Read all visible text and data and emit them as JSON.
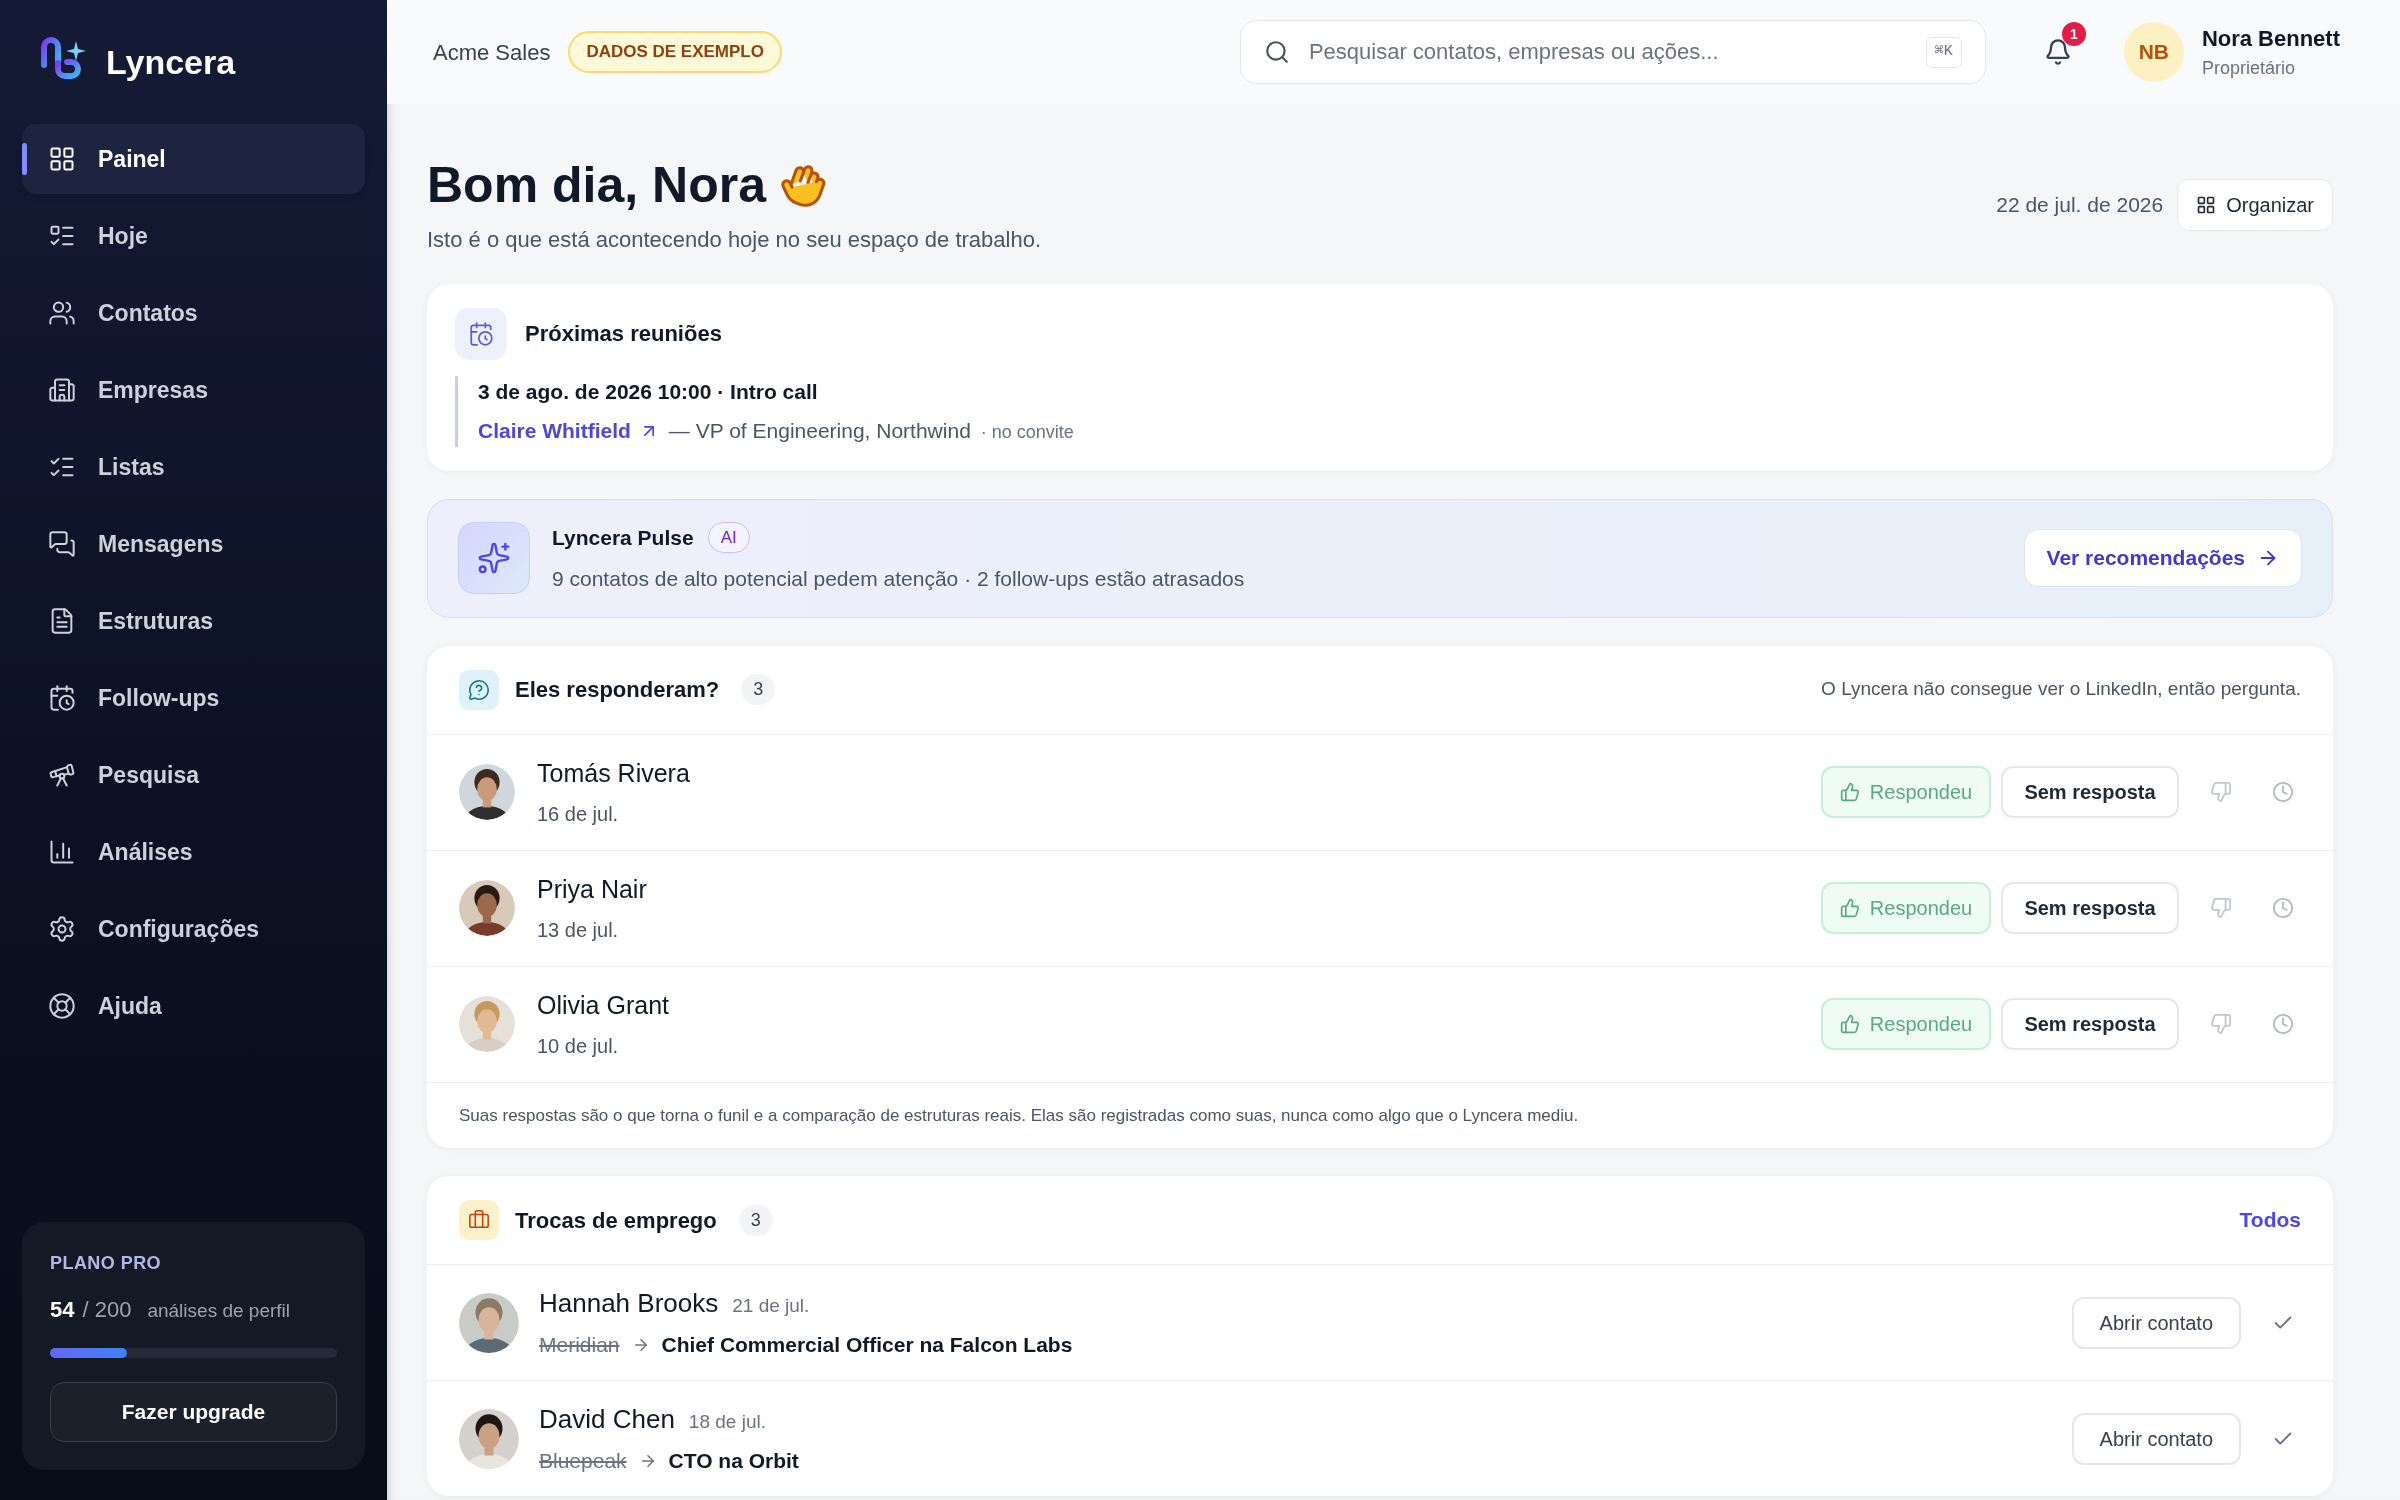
{
  "sidebar": {
    "brand": "Lyncera",
    "items": [
      {
        "label": "Painel",
        "selected": true
      },
      {
        "label": "Hoje",
        "selected": false
      },
      {
        "label": "Contatos",
        "selected": false
      },
      {
        "label": "Empresas",
        "selected": false
      },
      {
        "label": "Listas",
        "selected": false
      },
      {
        "label": "Mensagens",
        "selected": false
      },
      {
        "label": "Estruturas",
        "selected": false
      },
      {
        "label": "Follow-ups",
        "selected": false
      },
      {
        "label": "Pesquisa",
        "selected": false
      },
      {
        "label": "Análises",
        "selected": false
      },
      {
        "label": "Configurações",
        "selected": false
      },
      {
        "label": "Ajuda",
        "selected": false
      }
    ],
    "plan": {
      "title": "PLANO PRO",
      "used": "54",
      "total": "/ 200",
      "unit": "análises de perfil",
      "level": 0.27,
      "button": "Fazer upgrade"
    }
  },
  "header": {
    "workspace": "Acme Sales",
    "badge": "DADOS DE EXEMPLO",
    "search": {
      "placeholder": "Pesquisar contatos, empresas ou ações...",
      "shortcut": "⌘K"
    },
    "notifications": "1",
    "user": {
      "initials": "NB",
      "name": "Nora Bennett",
      "role": "Proprietário"
    }
  },
  "greeting": {
    "title": "Bom dia, Nora",
    "subtitle": "Isto é o que está acontecendo hoje no seu espaço de trabalho.",
    "date": "22 de jul. de 2026",
    "organize": "Organizar"
  },
  "meetings": {
    "title": "Próximas reuniões",
    "items": [
      {
        "when": "3 de ago. de 2026 10:00 · Intro call",
        "contact": "Claire Whitfield",
        "details": "— VP of Engineering, Northwind",
        "note": "· no convite"
      }
    ]
  },
  "pulse": {
    "title": "Lyncera Pulse",
    "badge": "AI",
    "text": "9 contatos de alto potencial pedem atenção · 2 follow-ups estão atrasados",
    "action": "Ver recomendações"
  },
  "replies": {
    "title": "Eles responderam?",
    "count": "3",
    "hint": "O Lyncera não consegue ver o LinkedIn, então pergunta.",
    "rows": [
      {
        "name": "Tomás Rivera",
        "date": "16 de jul.",
        "replied": "Respondeu",
        "no_reply": "Sem resposta"
      },
      {
        "name": "Priya Nair",
        "date": "13 de jul.",
        "replied": "Respondeu",
        "no_reply": "Sem resposta"
      },
      {
        "name": "Olivia Grant",
        "date": "10 de jul.",
        "replied": "Respondeu",
        "no_reply": "Sem resposta"
      }
    ],
    "footer": "Suas respostas são o que torna o funil e a comparação de estruturas reais. Elas são registradas como suas, nunca como algo que o Lyncera mediu."
  },
  "job_changes": {
    "title": "Trocas de emprego",
    "count": "3",
    "action": "Todos",
    "rows": [
      {
        "name": "Hannah Brooks",
        "date": "21 de jul.",
        "from": "Meridian",
        "to": "Chief Commercial Officer na Falcon Labs",
        "button": "Abrir contato"
      },
      {
        "name": "David Chen",
        "date": "18 de jul.",
        "from": "Bluepeak",
        "to": "CTO na Orbit",
        "button": "Abrir contato"
      }
    ]
  }
}
